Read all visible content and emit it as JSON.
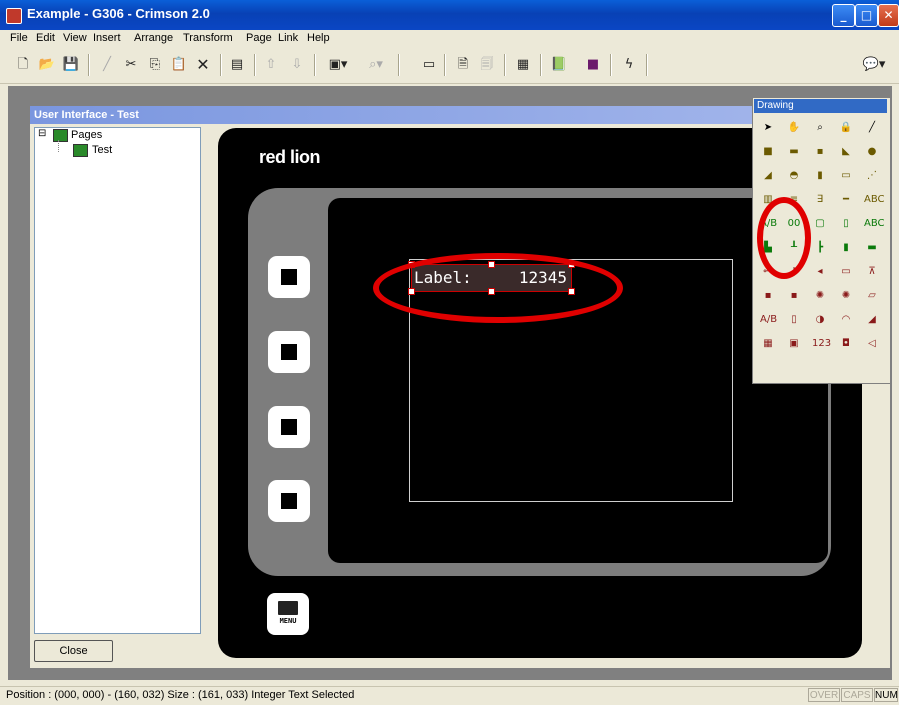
{
  "window": {
    "title": "Example - G306 - Crimson 2.0",
    "min_label": "_",
    "max_label": "□",
    "close_label": "✕"
  },
  "menu": [
    {
      "label": "File"
    },
    {
      "label": "Edit"
    },
    {
      "label": "View"
    },
    {
      "label": "Insert"
    },
    {
      "label": "Arrange"
    },
    {
      "label": "Transform"
    },
    {
      "label": "Page"
    },
    {
      "label": "Link"
    },
    {
      "label": "Help"
    }
  ],
  "toolbar": {
    "icons": [
      "new-icon",
      "open-icon",
      "save-icon",
      "pencil-icon",
      "cut-icon",
      "copy-icon",
      "paste-icon",
      "delete-icon",
      "properties-icon",
      "up-arrow-icon",
      "down-arrow-icon",
      "fill-icon",
      "zoom-icon",
      "frame-icon",
      "page-icon",
      "page2-icon",
      "grid-icon",
      "book-icon",
      "palette-icon",
      "lightning-icon",
      "chat-icon"
    ],
    "glyphs": [
      "🗋",
      "📂",
      "💾",
      "╱",
      "✂",
      "⎘",
      "📋",
      "✕",
      "▤",
      "⇧",
      "⇩",
      "▣▾",
      "⌕▾",
      "▭",
      "🗎",
      "🗐",
      "▦",
      "📗",
      "■",
      "ϟ",
      "💬▾"
    ]
  },
  "child_window": {
    "title": "User Interface - Test"
  },
  "tree": {
    "root": "Pages",
    "expander": "⊟",
    "child": "Test"
  },
  "close_button": "Close",
  "device": {
    "brand": "red lion",
    "menu_key_label": "MENU",
    "widget_label": "Label:",
    "widget_value": "12345"
  },
  "palette": {
    "title": "Drawing",
    "tools": [
      "➤",
      "✋",
      "⌕",
      "🔒",
      "╱",
      "■",
      "▬",
      "▪",
      "◣",
      "●",
      "◢",
      "◓",
      "▮",
      "▭",
      "⋰",
      "▥",
      "≡",
      "∃",
      "━",
      "ABC",
      "A/B",
      "00",
      "▢",
      "▯",
      "ABC",
      "▙",
      "┸",
      "┣",
      "▮",
      "▬",
      "⊶",
      "!",
      "◂",
      "▭",
      "⊼",
      "▪",
      "▪",
      "✺",
      "✺",
      "▱",
      "A/B",
      "▯",
      "◑",
      "◠",
      "◢",
      "▦",
      "▣",
      "123",
      "◘",
      "◁"
    ]
  },
  "statusbar": {
    "text": "Position : (000, 000) - (160, 032)  Size : (161, 033)  Integer Text Selected",
    "indicators": [
      {
        "label": "OVER",
        "on": false
      },
      {
        "label": "CAPS",
        "on": false
      },
      {
        "label": "NUM",
        "on": true
      }
    ]
  }
}
